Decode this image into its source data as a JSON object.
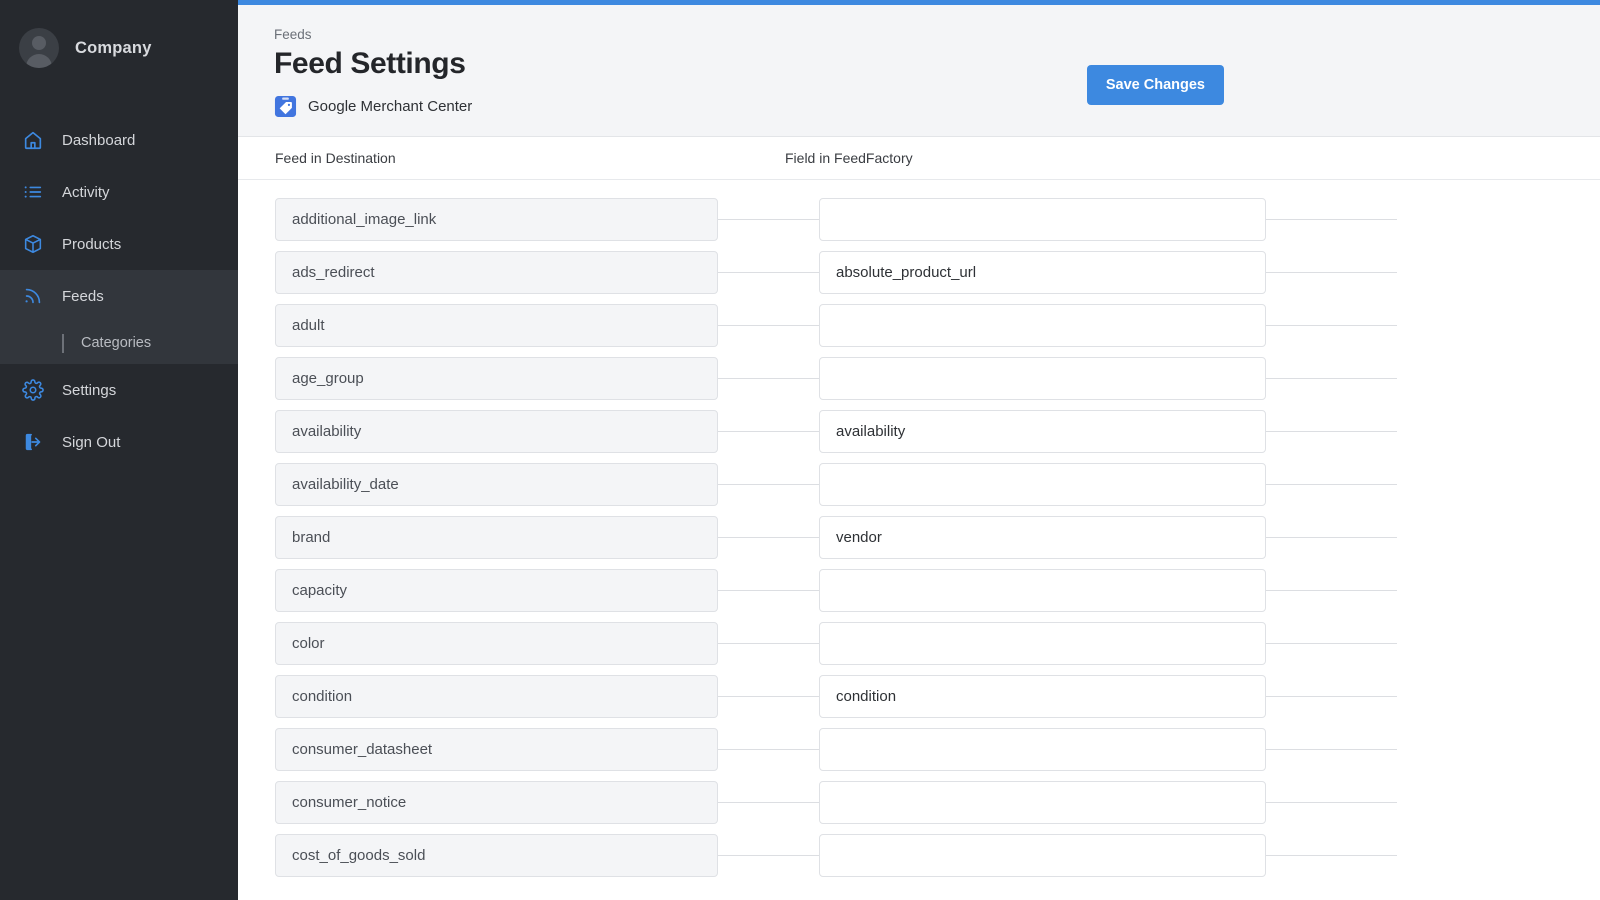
{
  "theme": {
    "accent": "#3d89e0",
    "sidebar_bg": "#26292e",
    "sidebar_active_bg": "#32363c",
    "header_bg": "#f4f5f7",
    "field_disabled_bg": "#f4f5f7",
    "border": "#dfe1e5"
  },
  "sidebar": {
    "brand": {
      "name": "Company",
      "avatar": "user-avatar-icon"
    },
    "items": [
      {
        "label": "Dashboard",
        "icon": "home-icon",
        "active": false
      },
      {
        "label": "Activity",
        "icon": "list-icon",
        "active": false
      },
      {
        "label": "Products",
        "icon": "box-icon",
        "active": false
      },
      {
        "label": "Feeds",
        "icon": "rss-feed-icon",
        "active": true,
        "children": [
          {
            "label": "Categories"
          }
        ]
      },
      {
        "label": "Settings",
        "icon": "gear-icon",
        "active": false
      },
      {
        "label": "Sign Out",
        "icon": "sign-out-icon",
        "active": false
      }
    ]
  },
  "header": {
    "breadcrumb": "Feeds",
    "title": "Feed Settings",
    "destination": {
      "label": "Google Merchant Center",
      "icon": "google-merchant-center-icon"
    },
    "save_label": "Save Changes"
  },
  "table": {
    "columns": {
      "destination": "Feed in Destination",
      "source": "Field in FeedFactory"
    },
    "rows": [
      {
        "destination": "additional_image_link",
        "source": ""
      },
      {
        "destination": "ads_redirect",
        "source": "absolute_product_url"
      },
      {
        "destination": "adult",
        "source": ""
      },
      {
        "destination": "age_group",
        "source": ""
      },
      {
        "destination": "availability",
        "source": "availability"
      },
      {
        "destination": "availability_date",
        "source": ""
      },
      {
        "destination": "brand",
        "source": "vendor"
      },
      {
        "destination": "capacity",
        "source": ""
      },
      {
        "destination": "color",
        "source": ""
      },
      {
        "destination": "condition",
        "source": "condition"
      },
      {
        "destination": "consumer_datasheet",
        "source": ""
      },
      {
        "destination": "consumer_notice",
        "source": ""
      },
      {
        "destination": "cost_of_goods_sold",
        "source": ""
      }
    ]
  }
}
